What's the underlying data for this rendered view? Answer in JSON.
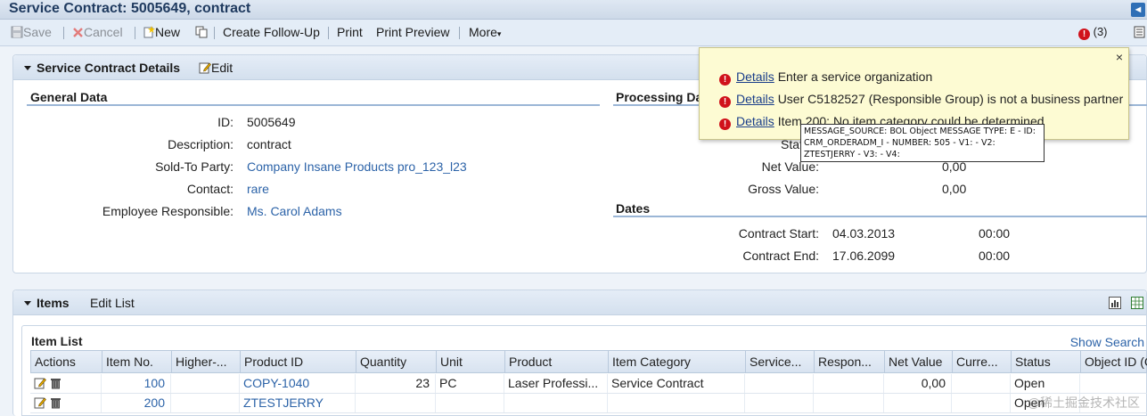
{
  "window": {
    "title": "Service Contract: 5005649, contract",
    "back_glyph": "◄"
  },
  "toolbar": {
    "save": "Save",
    "cancel": "Cancel",
    "new": "New",
    "create_follow_up": "Create Follow-Up",
    "print": "Print",
    "print_preview": "Print Preview",
    "more": "More",
    "message_count": "(3)"
  },
  "details_block": {
    "title": "Service Contract Details",
    "edit": "Edit",
    "general": {
      "title": "General Data",
      "fields": [
        {
          "label": "ID:",
          "value": "5005649"
        },
        {
          "label": "Description:",
          "value": "contract"
        },
        {
          "label": "Sold-To Party:",
          "value": "Company Insane Products pro_123_l23"
        },
        {
          "label": "Contact:",
          "value": "rare"
        },
        {
          "label": "Employee Responsible:",
          "value": "Ms. Carol Adams"
        }
      ]
    },
    "processing": {
      "title": "Processing Da",
      "status_label": "Stat",
      "net_value_label": "Net Value:",
      "net_value": "0,00",
      "gross_value_label": "Gross Value:",
      "gross_value": "0,00"
    },
    "dates": {
      "title": "Dates",
      "contract_start_label": "Contract Start:",
      "contract_start_date": "04.03.2013",
      "contract_start_time": "00:00",
      "contract_end_label": "Contract End:",
      "contract_end_date": "17.06.2099",
      "contract_end_time": "00:00"
    }
  },
  "messages": {
    "close": "×",
    "link_text": "Details",
    "items": [
      "Enter a service organization",
      "User C5182527 (Responsible Group) is not a business partner",
      "Item 200: No item category could be determined"
    ],
    "tooltip_lines": [
      "MESSAGE_SOURCE: BOL Object MESSAGE TYPE: E - ID:",
      "CRM_ORDERADM_I - NUMBER: 505 - V1:  - V2:",
      "ZTESTJERRY - V3:  - V4:"
    ]
  },
  "items_block": {
    "title": "Items",
    "edit_list": "Edit List",
    "table_title": "Item List",
    "show_search": "Show Search",
    "columns": [
      "Actions",
      "Item No.",
      "Higher-...",
      "Product ID",
      "Quantity",
      "Unit",
      "Product",
      "Item Category",
      "Service...",
      "Respon...",
      "Net Value",
      "Curre...",
      "Status",
      "Object ID (C"
    ],
    "rows": [
      {
        "item_no": "100",
        "higher": "",
        "product_id": "COPY-1040",
        "quantity": "23",
        "unit": "PC",
        "product": "Laser Professi...",
        "item_category": "Service Contract",
        "service": "",
        "respon": "",
        "net_value": "0,00",
        "currency": "",
        "status": "Open",
        "object_id": ""
      },
      {
        "item_no": "200",
        "higher": "",
        "product_id": "ZTESTJERRY",
        "quantity": "",
        "unit": "",
        "product": "",
        "item_category": "",
        "service": "",
        "respon": "",
        "net_value": "",
        "currency": "",
        "status": "Open",
        "object_id": ""
      }
    ]
  },
  "watermark": "@稀土掘金技术社区",
  "colors": {
    "link": "#2c63a8",
    "error": "#d0121b",
    "header": "#d4e0ee"
  }
}
